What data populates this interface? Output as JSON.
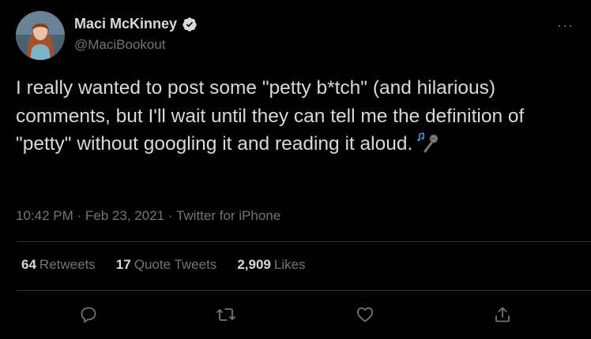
{
  "author": {
    "display_name": "Maci McKinney",
    "handle": "@MaciBookout",
    "verified": true,
    "avatar_icon": "profile-photo"
  },
  "more_icon": "more-icon",
  "tweet": {
    "text": "I really wanted to post some \"petty b*tch\" (and hilarious) comments, but I'll wait until they can tell me the definition of \"petty\" without googling it and reading it aloud.",
    "emoji": "microphone-music-emoji"
  },
  "meta": {
    "time": "10:42 PM",
    "separator": "·",
    "date": "Feb 23, 2021",
    "source": "Twitter for iPhone"
  },
  "stats": {
    "retweets_count": "64",
    "retweets_label": "Retweets",
    "quotes_count": "17",
    "quotes_label": "Quote Tweets",
    "likes_count": "2,909",
    "likes_label": "Likes"
  },
  "colors": {
    "background": "#000000",
    "text": "#d9d9d9",
    "secondary": "#6e767d",
    "divider": "#2f3336",
    "verified_badge": "#d9d9d9"
  }
}
